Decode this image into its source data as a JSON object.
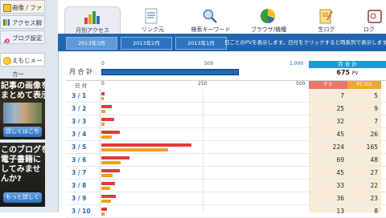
{
  "sidebar": {
    "items": [
      {
        "label": "画像 / ファイル",
        "icon": "image-icon"
      },
      {
        "label": "アクセス解析",
        "icon": "chart-icon"
      },
      {
        "label": "ブログ設定",
        "icon": "wrench-icon"
      },
      {
        "label": "えもじメーカー",
        "icon": "emoji-icon"
      }
    ],
    "banner1": {
      "line1": "記事の画像を",
      "line2": "まとめて表示!",
      "button": "詳しくはこちら"
    },
    "banner2": {
      "line1": "このブログを",
      "line2": "電子書籍に",
      "line3": "してみませ",
      "line4": "んか?",
      "button": "もっと詳しく"
    }
  },
  "tabs": [
    {
      "label": "月別アクセス",
      "icon": "bar-chart-icon"
    },
    {
      "label": "リンク元",
      "icon": "link-page-icon"
    },
    {
      "label": "検索キーワード",
      "icon": "magnifier-icon"
    },
    {
      "label": "ブラウザ/機種",
      "icon": "pie-chart-icon"
    },
    {
      "label": "生ログ",
      "icon": "notepad-icon"
    },
    {
      "label": "ログ",
      "icon": "log-icon"
    }
  ],
  "months": [
    "2013年3月",
    "2013年2月",
    "2013年1月"
  ],
  "hint": "日ごとのPVを表示します。日付をクリックすると時系列で表示します。",
  "monthly": {
    "label": "月 合 計",
    "scale": [
      "0",
      "500",
      "1,000"
    ],
    "total_label": "月 合 計",
    "total_value": "675",
    "total_unit": "PV",
    "total_fraction": 0.675
  },
  "table": {
    "day_header": "日 付",
    "axis": [
      "0",
      "250",
      "500"
    ],
    "pv_header": "P V",
    "pc_header": "PC (U)",
    "rows": [
      {
        "day": "3 / 1",
        "pv": "7",
        "pc": "5",
        "pv_val": 7,
        "pc_val": 5
      },
      {
        "day": "3 / 2",
        "pv": "25",
        "pc": "9",
        "pv_val": 25,
        "pc_val": 9
      },
      {
        "day": "3 / 3",
        "pv": "32",
        "pc": "7",
        "pv_val": 32,
        "pc_val": 7
      },
      {
        "day": "3 / 4",
        "pv": "45",
        "pc": "26",
        "pv_val": 45,
        "pc_val": 26
      },
      {
        "day": "3 / 5",
        "pv": "224",
        "pc": "165",
        "pv_val": 224,
        "pc_val": 165
      },
      {
        "day": "3 / 6",
        "pv": "69",
        "pc": "48",
        "pv_val": 69,
        "pc_val": 48
      },
      {
        "day": "3 / 7",
        "pv": "45",
        "pc": "27",
        "pv_val": 45,
        "pc_val": 27
      },
      {
        "day": "3 / 8",
        "pv": "33",
        "pc": "22",
        "pv_val": 33,
        "pc_val": 22
      },
      {
        "day": "3 / 9",
        "pv": "36",
        "pc": "23",
        "pv_val": 36,
        "pc_val": 23
      },
      {
        "day": "3 / 10",
        "pv": "13",
        "pc": "8",
        "pv_val": 13,
        "pc_val": 8
      }
    ]
  },
  "colors": {
    "accent": "#1f66b2",
    "pv_bar": "#e23a3a",
    "pc_bar": "#f1a020"
  }
}
